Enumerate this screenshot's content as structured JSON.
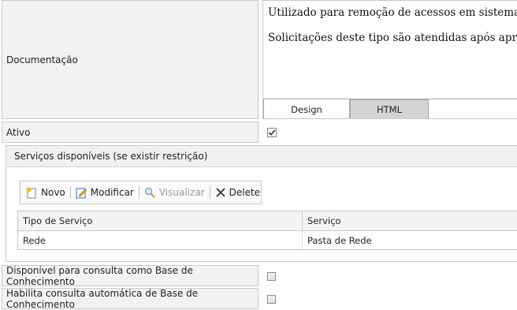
{
  "documentation": {
    "label": "Documentação",
    "line1": "Utilizado para remoção de acessos em sistemas d",
    "line2": "Solicitações deste tipo são atendidas após aprovac",
    "tabs": {
      "design": "Design",
      "html": "HTML"
    }
  },
  "ativo": {
    "label": "Ativo",
    "checked": true
  },
  "services": {
    "title": "Serviços disponíveis (se existir restrição)",
    "toolbar": {
      "novo": "Novo",
      "modificar": "Modificar",
      "visualizar": "Visualizar",
      "delete": "Delete"
    },
    "columns": [
      "Tipo de Serviço",
      "Serviço"
    ],
    "rows": [
      {
        "tipo": "Rede",
        "servico": "Pasta de Rede"
      }
    ]
  },
  "kb_consult": {
    "label": "Disponível para consulta como Base de Conhecimento",
    "checked": false
  },
  "kb_auto": {
    "label": "Habilita consulta automática de Base de Conhecimento",
    "checked": false
  }
}
